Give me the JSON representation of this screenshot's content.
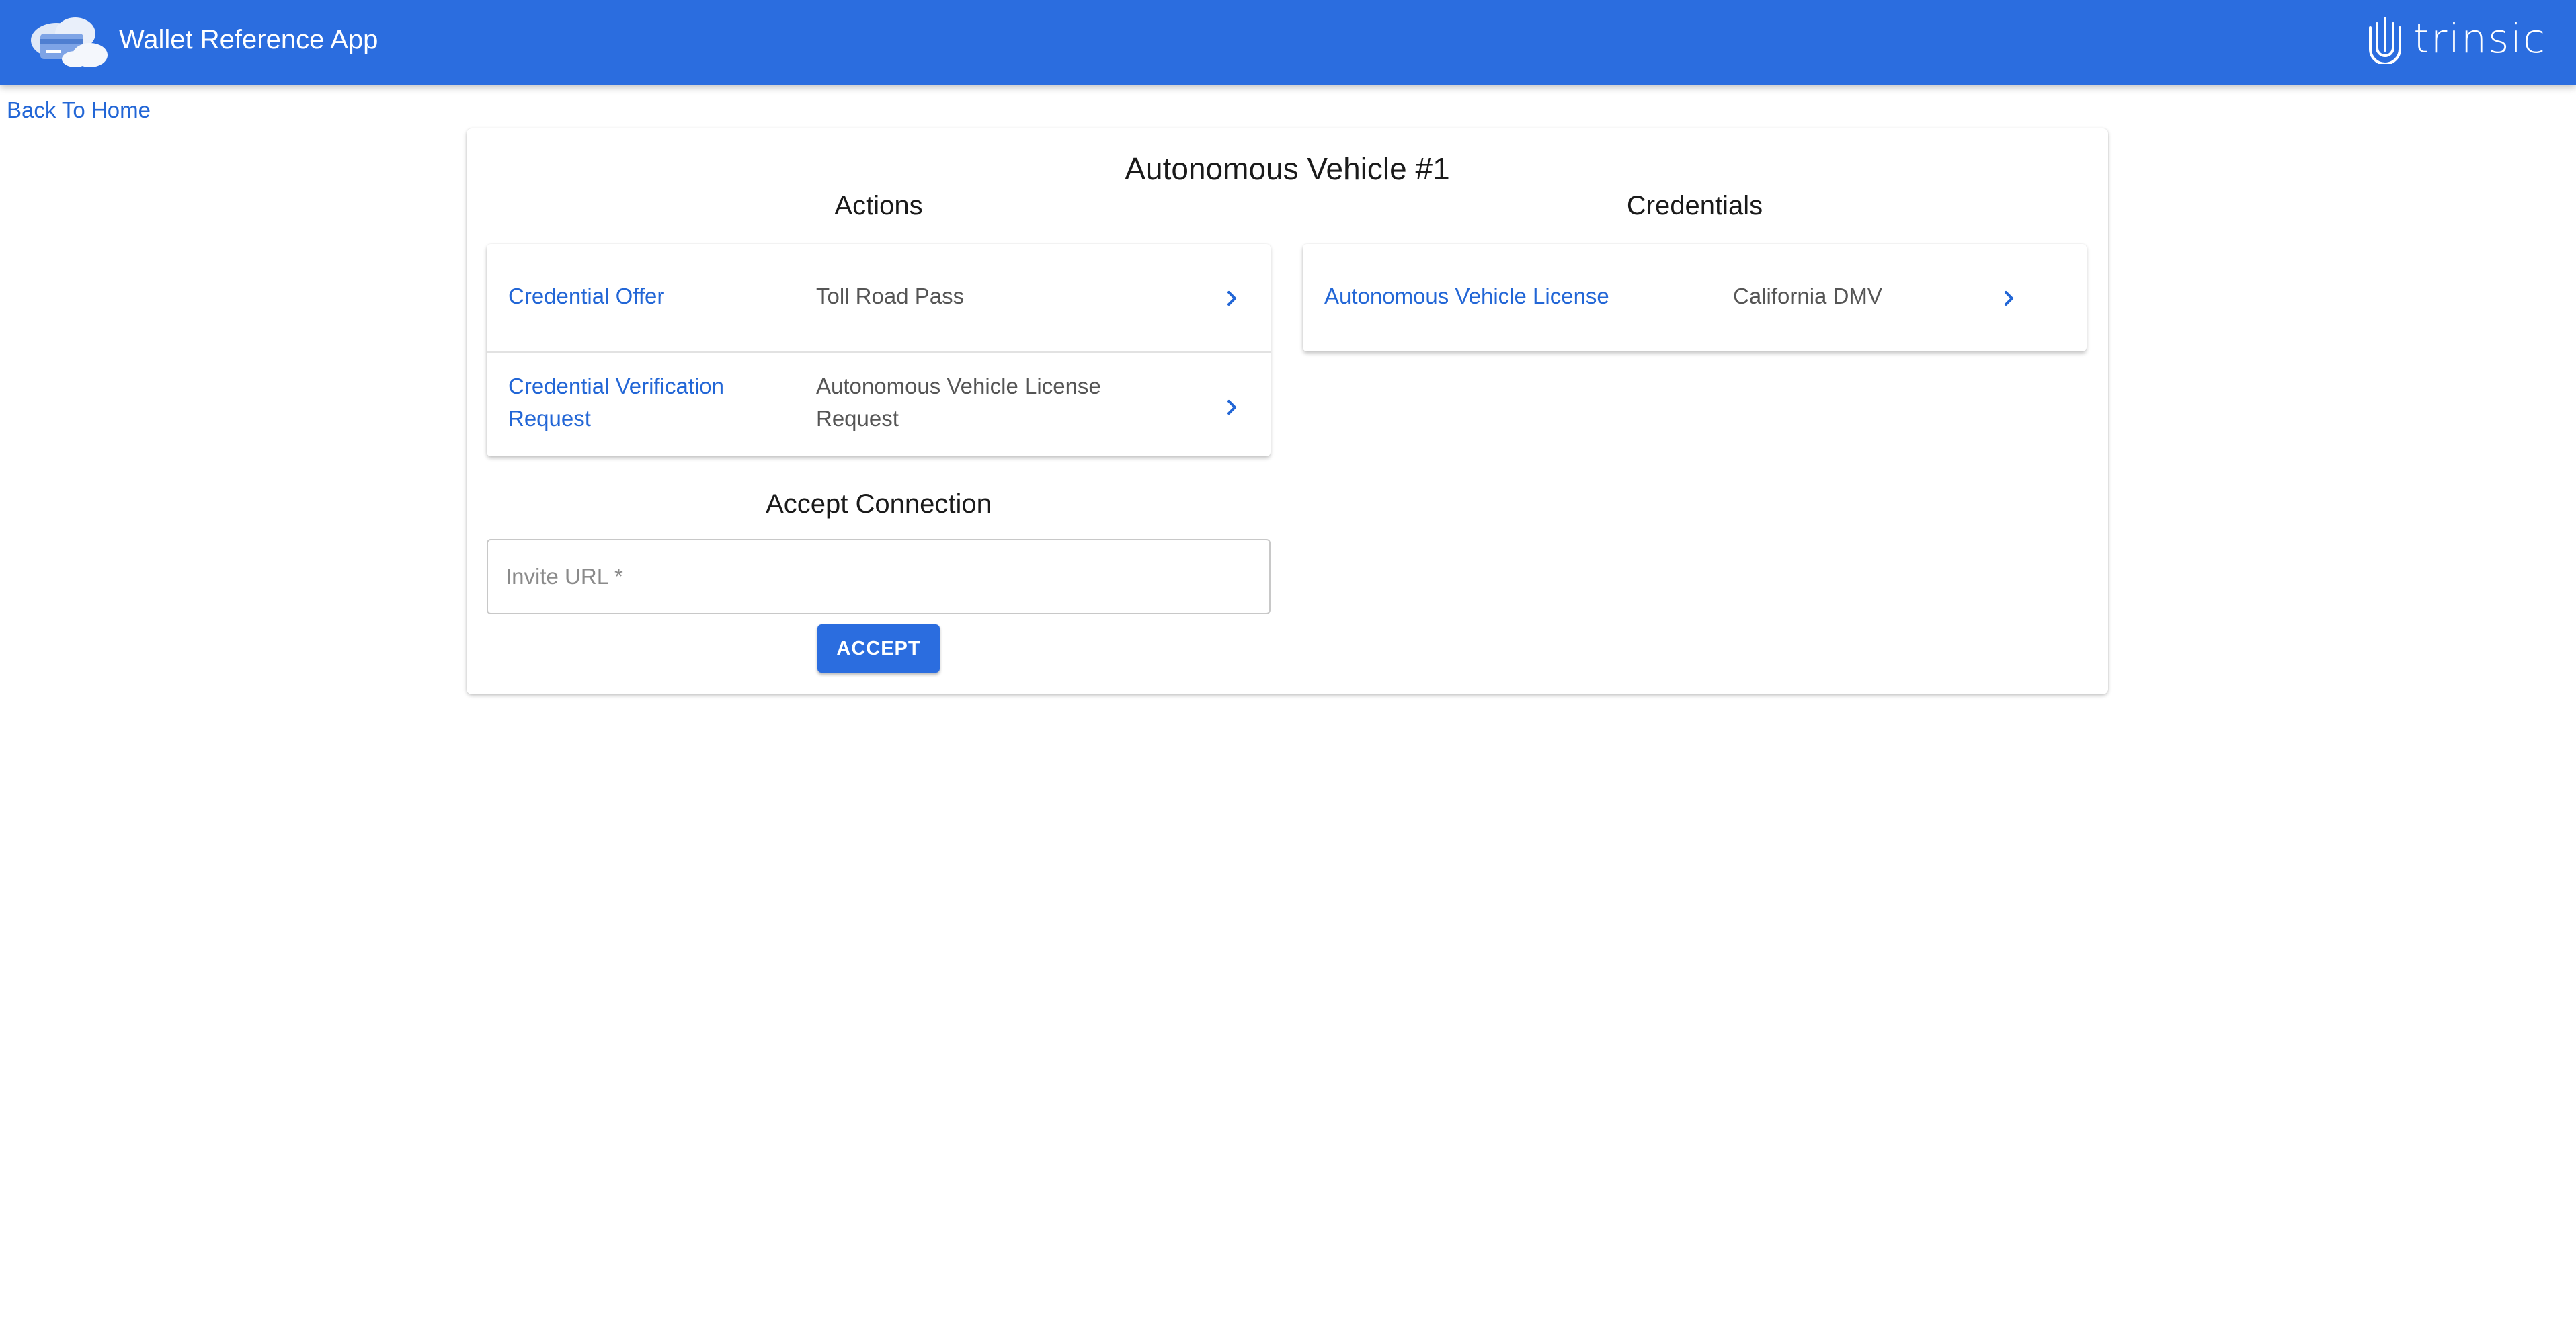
{
  "header": {
    "app_title": "Wallet Reference App",
    "brand_name": "trinsic",
    "logo_icon": "cloud-wallet-icon",
    "brand_icon": "trinsic-fingerprint-icon",
    "background_color": "#2b6ddf"
  },
  "nav": {
    "back_label": "Back To Home"
  },
  "main": {
    "title": "Autonomous Vehicle #1",
    "actions": {
      "heading": "Actions",
      "items": [
        {
          "label": "Credential Offer",
          "value": "Toll Road Pass",
          "icon": "chevron-right-icon"
        },
        {
          "label": "Credential Verification Request",
          "value": "Autonomous Vehicle License Request",
          "icon": "chevron-right-icon"
        }
      ]
    },
    "credentials": {
      "heading": "Credentials",
      "items": [
        {
          "label": "Autonomous Vehicle License",
          "value": "California DMV",
          "icon": "chevron-right-icon"
        }
      ]
    },
    "accept_connection": {
      "heading": "Accept Connection",
      "input_placeholder": "Invite URL *",
      "input_value": "",
      "button_label": "ACCEPT"
    }
  },
  "colors": {
    "accent": "#2b6ddf",
    "link": "#2266d6"
  }
}
